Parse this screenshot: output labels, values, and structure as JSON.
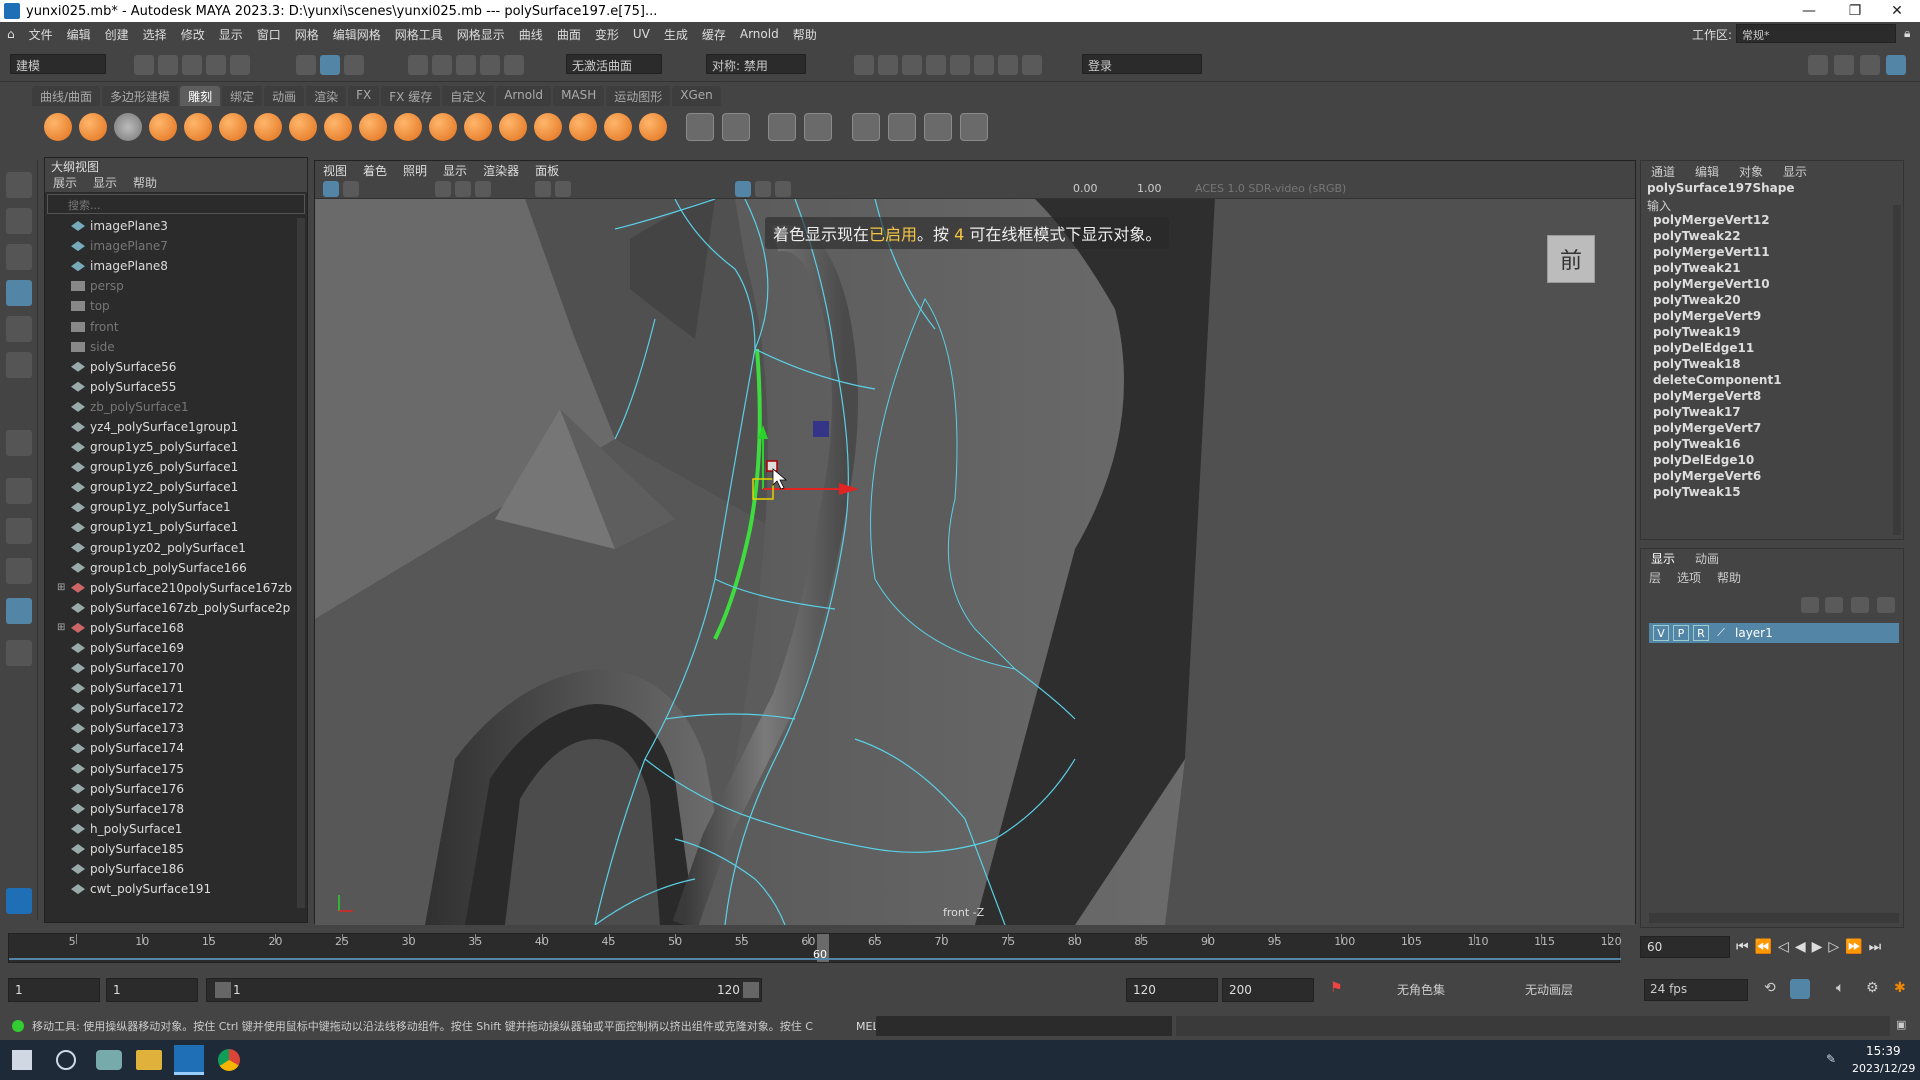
{
  "window": {
    "title": "yunxi025.mb* - Autodesk MAYA 2023.3: D:\\yunxi\\scenes\\yunxi025.mb   ---   polySurface197.e[75]..."
  },
  "menubar": {
    "items": [
      "文件",
      "编辑",
      "创建",
      "选择",
      "修改",
      "显示",
      "窗口",
      "网格",
      "编辑网格",
      "网格工具",
      "网格显示",
      "曲线",
      "曲面",
      "变形",
      "UV",
      "生成",
      "缓存",
      "Arnold",
      "帮助"
    ],
    "workspace_label": "工作区:",
    "workspace_value": "常规*"
  },
  "statusline": {
    "mode": "建模",
    "live_surface": "无激活曲面",
    "symmetry": "对称: 禁用",
    "login": "登录"
  },
  "shelf": {
    "tabs": [
      "曲线/曲面",
      "多边形建模",
      "雕刻",
      "绑定",
      "动画",
      "渲染",
      "FX",
      "FX 缓存",
      "自定义",
      "Arnold",
      "MASH",
      "运动图形",
      "XGen"
    ],
    "active_tab": "雕刻"
  },
  "outliner": {
    "title": "大纲视图",
    "menu": [
      "展示",
      "显示",
      "帮助"
    ],
    "search_placeholder": "搜索...",
    "items": [
      {
        "label": "imagePlane3",
        "dim": false,
        "type": "image"
      },
      {
        "label": "imagePlane7",
        "dim": true,
        "type": "image"
      },
      {
        "label": "imagePlane8",
        "dim": false,
        "type": "image"
      },
      {
        "label": "persp",
        "dim": true,
        "type": "camera"
      },
      {
        "label": "top",
        "dim": true,
        "type": "camera"
      },
      {
        "label": "front",
        "dim": true,
        "type": "camera"
      },
      {
        "label": "side",
        "dim": true,
        "type": "camera"
      },
      {
        "label": "polySurface56",
        "dim": false,
        "type": "mesh"
      },
      {
        "label": "polySurface55",
        "dim": false,
        "type": "mesh"
      },
      {
        "label": "zb_polySurface1",
        "dim": true,
        "type": "mesh"
      },
      {
        "label": "yz4_polySurface1group1",
        "dim": false,
        "type": "mesh"
      },
      {
        "label": "group1yz5_polySurface1",
        "dim": false,
        "type": "mesh"
      },
      {
        "label": "group1yz6_polySurface1",
        "dim": false,
        "type": "mesh"
      },
      {
        "label": "group1yz2_polySurface1",
        "dim": false,
        "type": "mesh"
      },
      {
        "label": "group1yz_polySurface1",
        "dim": false,
        "type": "mesh"
      },
      {
        "label": "group1yz1_polySurface1",
        "dim": false,
        "type": "mesh"
      },
      {
        "label": "group1yz02_polySurface1",
        "dim": false,
        "type": "mesh"
      },
      {
        "label": "group1cb_polySurface166",
        "dim": false,
        "type": "mesh"
      },
      {
        "label": "polySurface210polySurface167zb",
        "dim": false,
        "type": "group"
      },
      {
        "label": "polySurface167zb_polySurface2p",
        "dim": false,
        "type": "mesh"
      },
      {
        "label": "polySurface168",
        "dim": false,
        "type": "group"
      },
      {
        "label": "polySurface169",
        "dim": false,
        "type": "mesh"
      },
      {
        "label": "polySurface170",
        "dim": false,
        "type": "mesh"
      },
      {
        "label": "polySurface171",
        "dim": false,
        "type": "mesh"
      },
      {
        "label": "polySurface172",
        "dim": false,
        "type": "mesh"
      },
      {
        "label": "polySurface173",
        "dim": false,
        "type": "mesh"
      },
      {
        "label": "polySurface174",
        "dim": false,
        "type": "mesh"
      },
      {
        "label": "polySurface175",
        "dim": false,
        "type": "mesh"
      },
      {
        "label": "polySurface176",
        "dim": false,
        "type": "mesh"
      },
      {
        "label": "polySurface178",
        "dim": false,
        "type": "mesh"
      },
      {
        "label": "h_polySurface1",
        "dim": false,
        "type": "mesh"
      },
      {
        "label": "polySurface185",
        "dim": false,
        "type": "mesh"
      },
      {
        "label": "polySurface186",
        "dim": false,
        "type": "mesh"
      },
      {
        "label": "cwt_polySurface191",
        "dim": false,
        "type": "mesh"
      }
    ]
  },
  "viewport": {
    "menu": [
      "视图",
      "着色",
      "照明",
      "显示",
      "渲染器",
      "面板"
    ],
    "near_value": "0.00",
    "far_value": "1.00",
    "colorspace": "ACES 1.0 SDR-video (sRGB)",
    "hud_pre": "着色显示现在",
    "hud_highlight": "已启用",
    "hud_mid": "。按 ",
    "hud_key": "4",
    "hud_post": " 可在线框模式下显示对象。",
    "viewcube_label": "前",
    "camera_label": "front -Z"
  },
  "channelbox": {
    "menu": [
      "通道",
      "编辑",
      "对象",
      "显示"
    ],
    "shape": "polySurface197Shape",
    "inputs_label": "输入",
    "inputs": [
      "polyMergeVert12",
      "polyTweak22",
      "polyMergeVert11",
      "polyTweak21",
      "polyMergeVert10",
      "polyTweak20",
      "polyMergeVert9",
      "polyTweak19",
      "polyDelEdge11",
      "polyTweak18",
      "deleteComponent1",
      "polyMergeVert8",
      "polyTweak17",
      "polyMergeVert7",
      "polyTweak16",
      "polyDelEdge10",
      "polyMergeVert6",
      "polyTweak15"
    ]
  },
  "layers": {
    "tabs": [
      "显示",
      "动画"
    ],
    "menu": [
      "层",
      "选项",
      "帮助"
    ],
    "layer": {
      "v": "V",
      "p": "P",
      "r": "R",
      "name": "layer1"
    }
  },
  "timeslider": {
    "ticks": [
      "5",
      "10",
      "15",
      "20",
      "25",
      "30",
      "35",
      "40",
      "45",
      "50",
      "55",
      "60",
      "65",
      "70",
      "75",
      "80",
      "85",
      "90",
      "95",
      "100",
      "105",
      "110",
      "115",
      "120"
    ],
    "current": "60",
    "current_field": "60"
  },
  "rangeslider": {
    "start": "1",
    "start2": "1",
    "range_start": "1",
    "range_end": "120",
    "end": "120",
    "end2": "200",
    "character_set": "无角色集",
    "anim_layer": "无动画层",
    "fps": "24 fps"
  },
  "helpline": {
    "text": "移动工具: 使用操纵器移动对象。按住 Ctrl 键并使用鼠标中键拖动以沿法线移动组件。按住 Shift 键并拖动操纵器轴或平面控制柄以挤出组件或克隆对象。按住 C",
    "mel_label": "MEL"
  },
  "taskbar": {
    "time": "15:39",
    "date": "2023/12/29"
  },
  "colors": {
    "selection_edge": "#3fdc3f",
    "wire": "#5ad0e6",
    "accent": "#5285a6"
  }
}
